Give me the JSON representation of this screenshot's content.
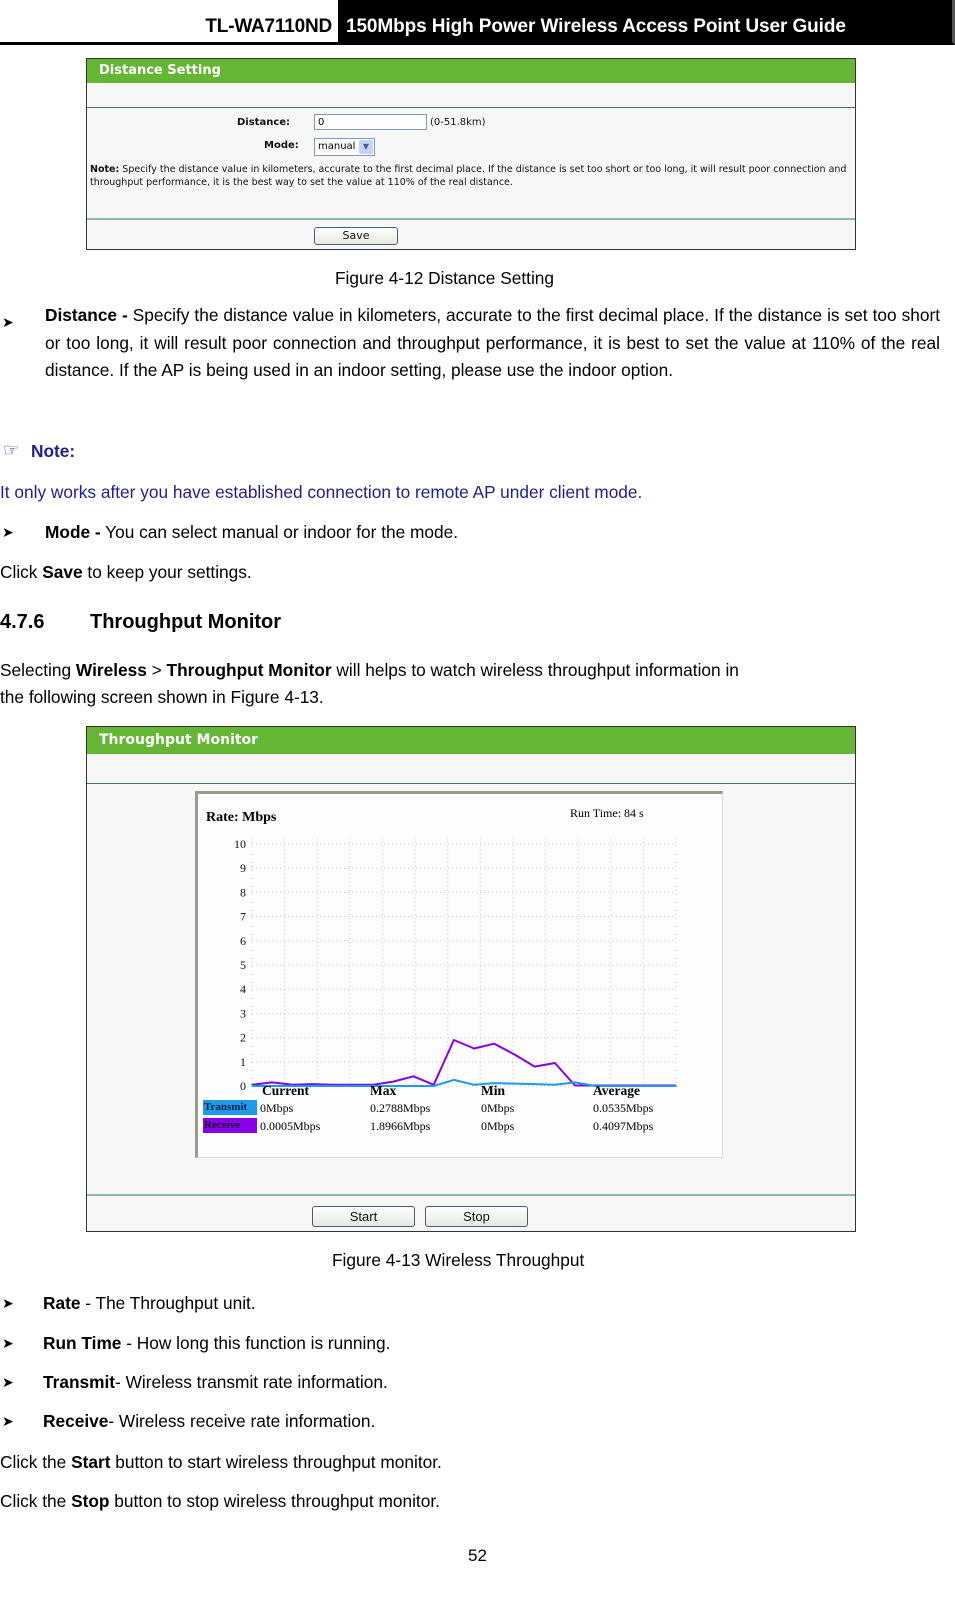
{
  "header": {
    "model": "TL-WA7110ND",
    "guide_title": "150Mbps High Power Wireless Access Point User Guide"
  },
  "distance_panel": {
    "title": "Distance Setting",
    "distance_label": "Distance:",
    "distance_value": "0",
    "distance_range": "(0-51.8km)",
    "mode_label": "Mode:",
    "mode_value": "manual",
    "note_bold": "Note:",
    "note_text": " Specify the distance value in kilometers, accurate to the first decimal place. If the distance is set too short or too long, it will result poor connection and throughput performance, it is the best way to set the value at 110% of the real distance.",
    "save_label": "Save"
  },
  "figure_12_caption": "Figure 4-12 Distance Setting",
  "distance_desc": {
    "term": "Distance -",
    "text": " Specify the distance value in kilometers, accurate to the first decimal place. If the distance is set too short or too long, it will result poor connection and throughput performance, it is best to set the value at 110% of the real distance. If the AP is being used in an indoor setting, please use the indoor option."
  },
  "note": {
    "icon": "pointing-hand-icon",
    "label": "Note:",
    "text": "It only works after you have established connection to remote AP under client mode."
  },
  "mode_desc": {
    "term": "Mode -",
    "text": " You can select manual or indoor for the mode."
  },
  "save_line": {
    "pre": "Click ",
    "bold": "Save",
    "post": " to keep your settings."
  },
  "section": {
    "number": "4.7.6",
    "title": "Throughput Monitor"
  },
  "intro": {
    "pre": "Selecting ",
    "bold1": "Wireless",
    "mid": " > ",
    "bold2": "Throughput Monitor",
    "post": " will helps to watch wireless throughput information in",
    "line2": "the following screen shown in Figure 4-13."
  },
  "throughput_panel": {
    "title": "Throughput Monitor",
    "rate_label": "Rate: Mbps",
    "run_time_label": "Run Time: 84 s",
    "columns": [
      "Current",
      "Max",
      "Min",
      "Average"
    ],
    "rows": [
      {
        "name": "Transmit",
        "color": "#1e9be8",
        "current": "0Mbps",
        "max": "0.2788Mbps",
        "min": "0Mbps",
        "average": "0.0535Mbps"
      },
      {
        "name": "Receive",
        "color": "#8a00e6",
        "current": "0.0005Mbps",
        "max": "1.8966Mbps",
        "min": "0Mbps",
        "average": "0.4097Mbps"
      }
    ],
    "start_label": "Start",
    "stop_label": "Stop"
  },
  "chart_data": {
    "type": "line",
    "title": "Rate: Mbps",
    "annotation": "Run Time: 84 s",
    "xlabel": "",
    "ylabel": "Mbps",
    "ylim": [
      0,
      10
    ],
    "yticks": [
      0,
      1,
      2,
      3,
      4,
      5,
      6,
      7,
      8,
      9,
      10
    ],
    "grid": true,
    "x": [
      0,
      1,
      2,
      3,
      4,
      5,
      6,
      7,
      8,
      9,
      10,
      11,
      12,
      13,
      14,
      15,
      16,
      17,
      18,
      19,
      20,
      21
    ],
    "series": [
      {
        "name": "Transmit",
        "color": "#1e9be8",
        "values": [
          0,
          0,
          0,
          0,
          0,
          0,
          0,
          0,
          0,
          0,
          0.25,
          0.05,
          0.12,
          0.1,
          0.08,
          0.05,
          0.15,
          0,
          0,
          0,
          0,
          0
        ]
      },
      {
        "name": "Receive",
        "color": "#8a00e6",
        "values": [
          0.05,
          0.15,
          0.05,
          0.08,
          0.05,
          0.05,
          0.05,
          0.18,
          0.4,
          0.05,
          1.9,
          1.55,
          1.75,
          1.3,
          0.8,
          0.95,
          0.02,
          0.02,
          0.02,
          0.02,
          0.02,
          0.02
        ]
      }
    ]
  },
  "figure_13_caption": "Figure 4-13 Wireless Throughput",
  "field_desc": [
    {
      "term": "Rate",
      "text": " - The Throughput unit."
    },
    {
      "term": "Run Time",
      "text": " - How long this function is running."
    },
    {
      "term": "Transmit",
      "text": "- Wireless transmit rate information."
    },
    {
      "term": "Receive",
      "text": "- Wireless receive rate information."
    }
  ],
  "start_line": {
    "pre": "Click the ",
    "bold": "Start",
    "post": " button to start wireless throughput monitor."
  },
  "stop_line": {
    "pre": "Click the ",
    "bold": "Stop",
    "post": " button to stop wireless throughput monitor."
  },
  "page_number": "52"
}
